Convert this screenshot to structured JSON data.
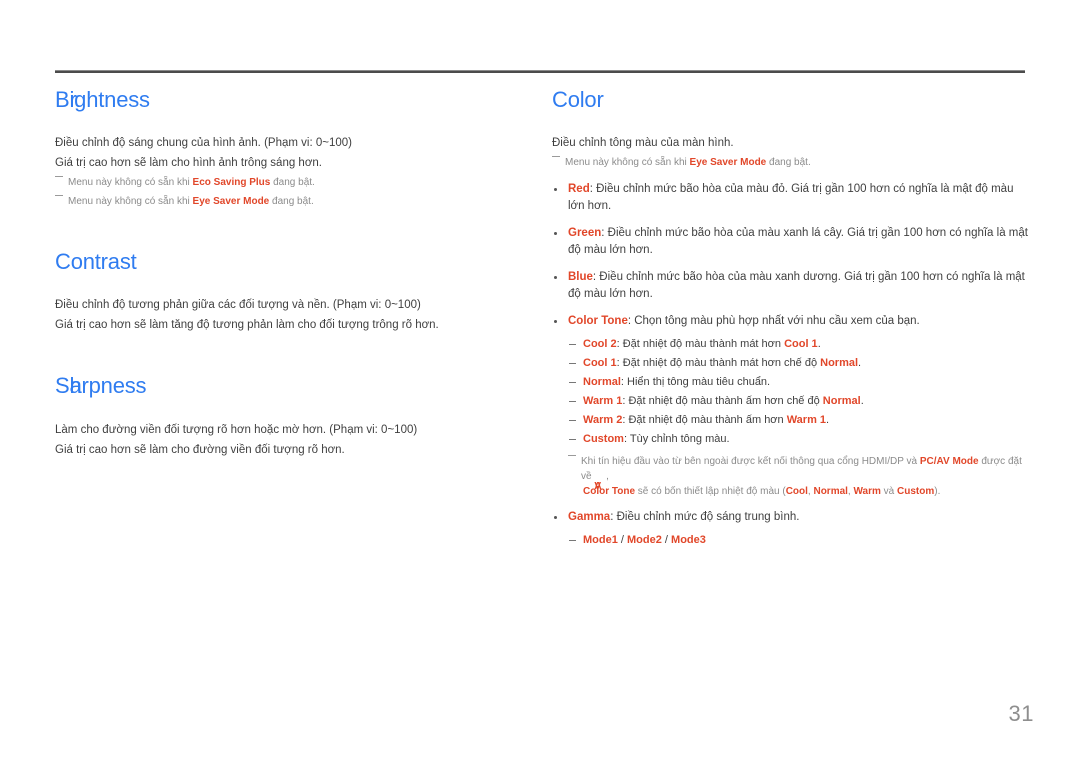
{
  "page": {
    "number": "31",
    "accent_blue": "#2f7cf0",
    "accent_red": "#e1472a",
    "body_color": "#3f3f3f",
    "note_color": "#8b8b8b"
  },
  "left_column": {
    "sections": [
      {
        "title": "Brightness",
        "title_head": "B",
        "title_overlap": "r",
        "title_rest": "ightness",
        "lines": [
          "Điều chỉnh độ sáng chung của hình ảnh. (Phạm vi: 0~100)",
          "Giá trị cao hơn sẽ làm cho hình ảnh trông sáng hơn."
        ],
        "notes": [
          {
            "pre": "Menu này không có sẵn khi ",
            "kw": "Eco Saving Plus",
            "post": " đang bật."
          },
          {
            "pre": "Menu này không có sẵn khi ",
            "kw": "Eye Saver Mode",
            "post": " đang bật."
          }
        ]
      },
      {
        "title": "Contrast",
        "title_head": "Contrast",
        "title_overlap": "",
        "title_rest": "",
        "lines": [
          "Điều chỉnh độ tương phản giữa các đối tượng và nền. (Phạm vi: 0~100)",
          "Giá trị cao hơn sẽ làm tăng độ tương phản làm cho đối tượng trông rõ hơn."
        ],
        "notes": []
      },
      {
        "title": "Sharpness",
        "title_head": "S",
        "title_overlap": "h",
        "title_rest": "arpness",
        "lines": [
          "Làm cho đường viền đối tượng rõ hơn hoặc mờ hơn. (Phạm vi: 0~100)",
          "Giá trị cao hơn sẽ làm cho đường viền đối tượng rõ hơn."
        ],
        "notes": []
      }
    ]
  },
  "right_column": {
    "title": "Color",
    "intro": "Điều chỉnh tông màu của màn hình.",
    "intro_note": {
      "pre": "Menu này không có sẵn khi ",
      "kw": "Eye Saver Mode",
      "post": " đang bật."
    },
    "bullets": [
      {
        "kw": "Red",
        "text": ": Điều chỉnh mức bão hòa của màu đỏ. Giá trị gần 100 hơn có nghĩa là mật độ màu lớn hơn."
      },
      {
        "kw": "Green",
        "text": ": Điều chỉnh mức bão hòa của màu xanh lá cây. Giá trị gần 100 hơn có nghĩa là mật độ màu lớn hơn."
      },
      {
        "kw": "Blue",
        "text": ": Điều chỉnh mức bão hòa của màu xanh dương. Giá trị gần 100 hơn có nghĩa là mật độ màu lớn hơn."
      },
      {
        "kw": "Color Tone",
        "text": ": Chọn tông màu phù hợp nhất với nhu cầu xem của bạn."
      },
      {
        "kw": "Gamma",
        "text": ": Điều chỉnh mức độ sáng trung bình."
      }
    ],
    "color_tone_subitems": [
      {
        "kw": "Cool 2",
        "mid": ": Đặt nhiệt độ màu thành mát hơn ",
        "kw2": "Cool 1",
        "end": "."
      },
      {
        "kw": "Cool 1",
        "mid": ": Đặt nhiệt độ màu thành mát hơn chế độ ",
        "kw2": "Normal",
        "end": "."
      },
      {
        "kw": "Normal",
        "mid": ": Hiển thị tông màu tiêu chuẩn.",
        "kw2": "",
        "end": ""
      },
      {
        "kw": "Warm 1",
        "mid": ": Đặt nhiệt độ màu thành ấm hơn chế độ ",
        "kw2": "Normal",
        "end": "."
      },
      {
        "kw": "Warm 2",
        "mid": ": Đặt nhiệt độ màu thành ấm hơn ",
        "kw2": "Warm 1",
        "end": "."
      },
      {
        "kw": "Custom",
        "mid": ": Tùy chỉnh tông màu.",
        "kw2": "",
        "end": ""
      }
    ],
    "color_tone_note": {
      "p1": "Khi tín hiệu đầu vào từ bên ngoài được kết nối thông qua cổng HDMI/DP và ",
      "kw1": "PC/AV Mode",
      "p2": " được đặt về ",
      "glyph_a": "A",
      "glyph_b": "V",
      "p3": " , ",
      "kw2": "Color Tone",
      "p4": " sẽ có bốn thiết lập nhiệt độ màu (",
      "kw3": "Cool",
      "p5": ", ",
      "kw4": "Normal",
      "p6": ", ",
      "kw5": "Warm",
      "p7": " và ",
      "kw6": "Custom",
      "p8": ")."
    },
    "gamma_subitems": [
      {
        "kw": "Mode1",
        "sep": " / "
      },
      {
        "kw": "Mode2",
        "sep": " / "
      },
      {
        "kw": "Mode3",
        "sep": ""
      }
    ]
  }
}
